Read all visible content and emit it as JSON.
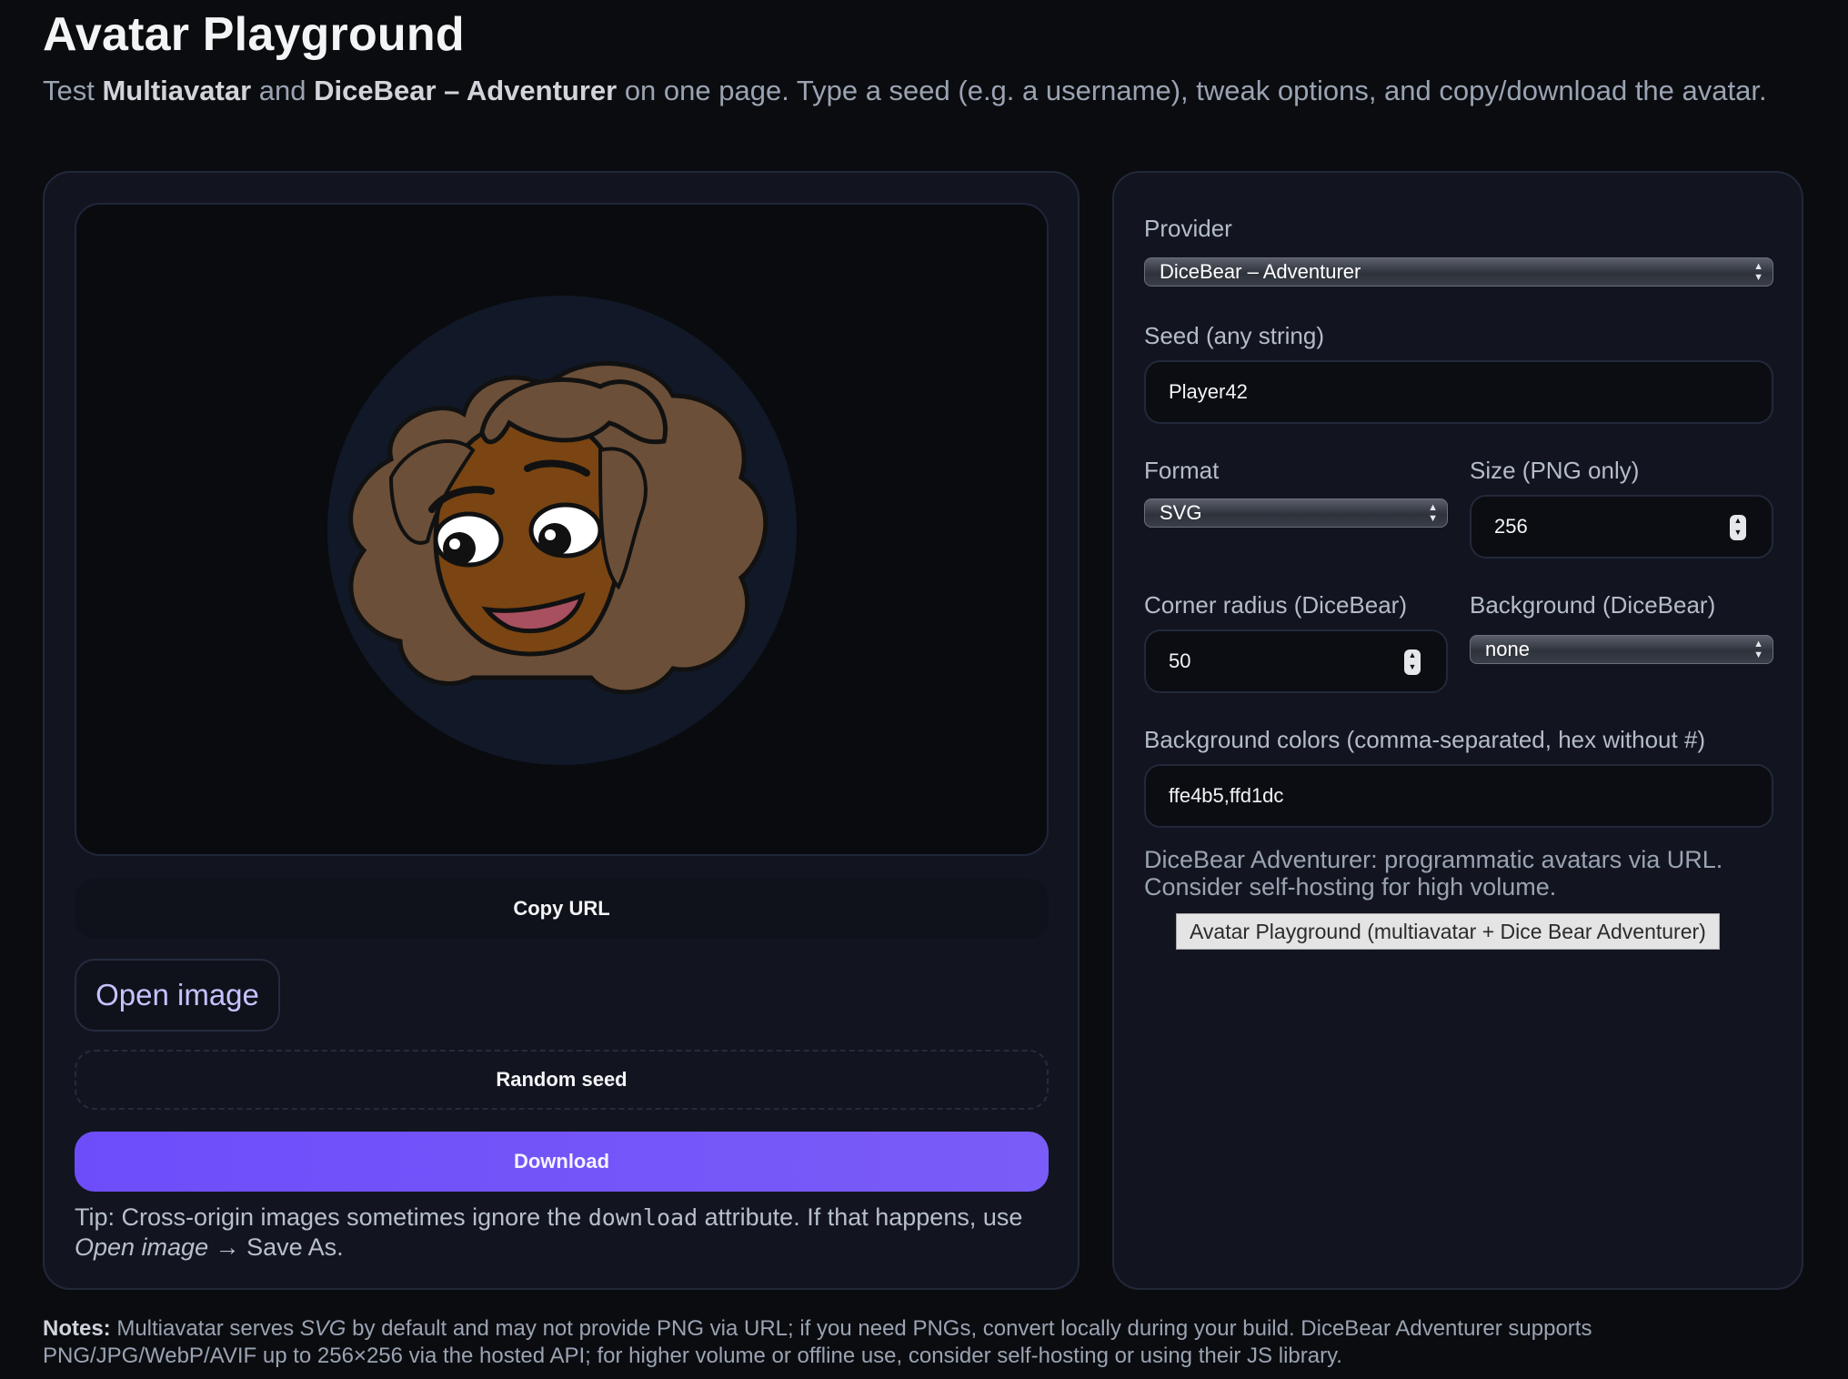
{
  "header": {
    "title": "Avatar Playground",
    "subtitle_prefix": "Test ",
    "subtitle_bold1": "Multiavatar",
    "subtitle_mid": " and ",
    "subtitle_bold2": "DiceBear – Adventurer",
    "subtitle_suffix": " on one page. Type a seed (e.g. a username), tweak options, and copy/download the avatar."
  },
  "left": {
    "copy_url_label": "Copy URL",
    "open_image_label": "Open image",
    "random_seed_label": "Random seed",
    "download_label": "Download",
    "tip_prefix": "Tip: Cross-origin images sometimes ignore the ",
    "tip_code": "download",
    "tip_mid": " attribute. If that happens, use ",
    "tip_em": "Open image",
    "tip_suffix": " → Save As."
  },
  "form": {
    "provider_label": "Provider",
    "provider_value": "DiceBear – Adventurer",
    "seed_label": "Seed (any string)",
    "seed_value": "Player42",
    "format_label": "Format",
    "format_value": "SVG",
    "size_label": "Size (PNG only)",
    "size_value": "256",
    "radius_label": "Corner radius (DiceBear)",
    "radius_value": "50",
    "background_label": "Background (DiceBear)",
    "background_value": "none",
    "bgcolors_label": "Background colors (comma-separated, hex without #)",
    "bgcolors_value": "ffe4b5,ffd1dc",
    "help_text": "DiceBear Adventurer: programmatic avatars via URL. Consider self-hosting for high volume.",
    "tooltip_text": "Avatar Playground (multiavatar + Dice Bear Adventurer)"
  },
  "notes": {
    "label": "Notes:",
    "part1": " Multiavatar serves ",
    "em": "SVG",
    "part2": " by default and may not provide PNG via URL; if you need PNGs, convert locally during your build. DiceBear Adventurer supports PNG/JPG/WebP/AVIF up to 256×256 via the hosted API; for higher volume or offline use, consider self-hosting or using their JS library."
  },
  "colors": {
    "accent": "#6d4dfa",
    "background": "#0b0c10",
    "card": "#121520",
    "avatar_circle": "#111827",
    "hair": "#6b4f38",
    "skin": "#7a4512",
    "mouth": "#a8505f"
  }
}
